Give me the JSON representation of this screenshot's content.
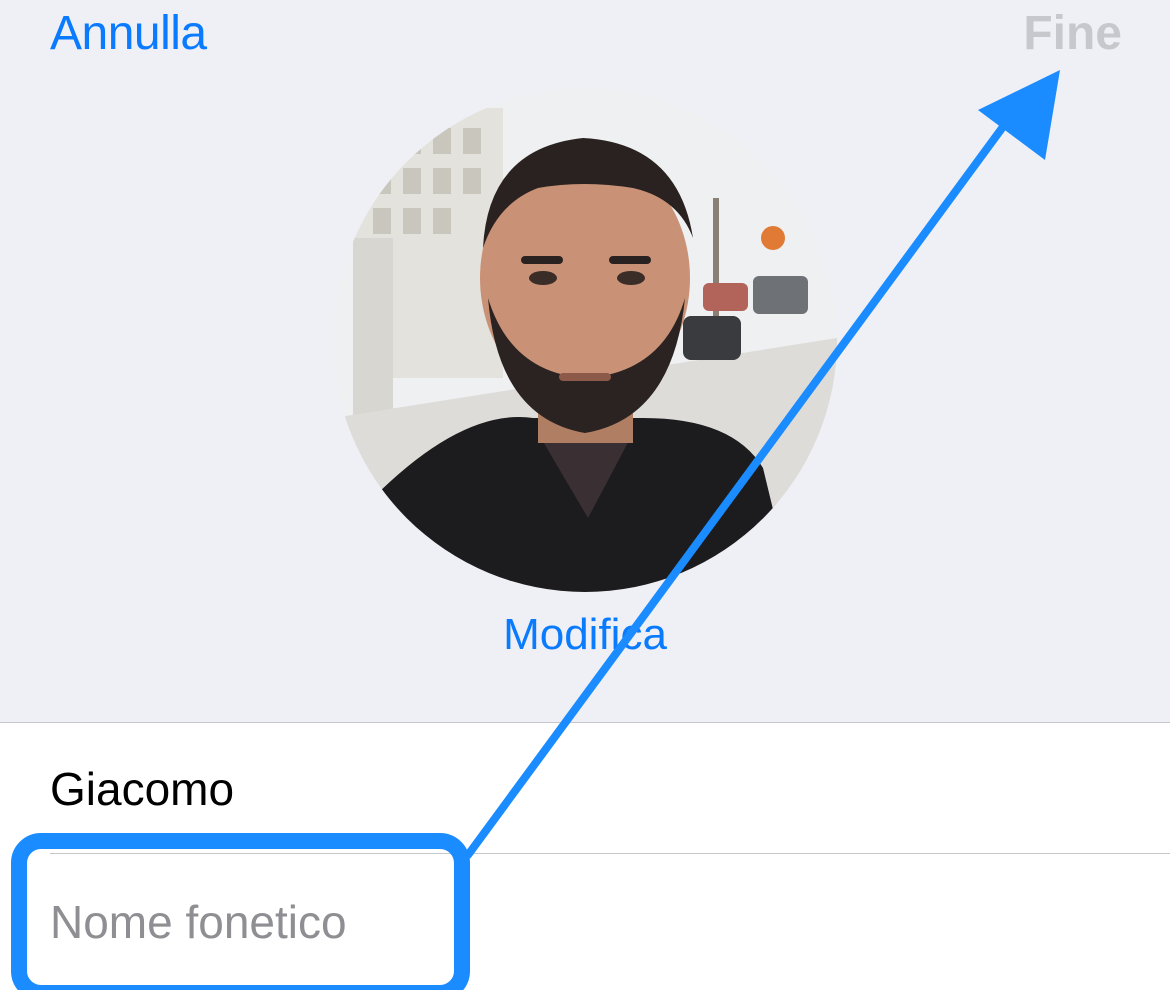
{
  "nav": {
    "cancel_label": "Annulla",
    "done_label": "Fine"
  },
  "profile": {
    "photo_icon": "contact-photo",
    "edit_label": "Modifica"
  },
  "form": {
    "first_name_value": "Giacomo",
    "phonetic_name_placeholder": "Nome fonetico"
  },
  "colors": {
    "accent": "#0a7bff",
    "disabled": "#c7c8cc",
    "annotation": "#1a8cff",
    "background": "#eff0f5"
  }
}
